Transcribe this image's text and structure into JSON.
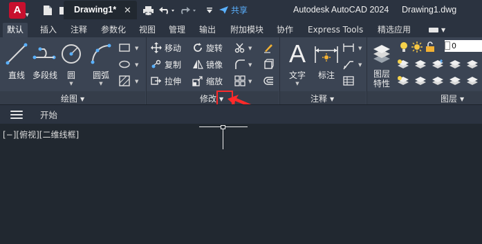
{
  "titlebar": {
    "logo_letter": "A",
    "share_label": "共享",
    "app_title": "Autodesk AutoCAD 2024",
    "file_name": "Drawing1.dwg",
    "quick_access": [
      "new-icon",
      "open-icon",
      "save-icon",
      "save-as-icon",
      "cloud-open-icon",
      "cloud-save-icon",
      "print-icon",
      "undo-icon",
      "redo-icon",
      "customize-icon"
    ]
  },
  "ribbon_tabs": [
    "默认",
    "插入",
    "注释",
    "参数化",
    "视图",
    "管理",
    "输出",
    "附加模块",
    "协作",
    "Express Tools",
    "精选应用"
  ],
  "ribbon": {
    "draw": {
      "title": "绘图",
      "line": "直线",
      "polyline": "多段线",
      "circle": "圆",
      "arc": "圆弧"
    },
    "modify": {
      "title": "修改",
      "move": "移动",
      "rotate": "旋转",
      "copy": "复制",
      "mirror": "镜像",
      "stretch": "拉伸",
      "scale": "缩放"
    },
    "annotation": {
      "title": "注释",
      "text": "文字",
      "dimension": "标注"
    },
    "layers": {
      "title": "图层",
      "properties_line1": "图层",
      "properties_line2": "特性",
      "current_layer": "0"
    }
  },
  "file_tabs": {
    "start": "开始",
    "active": "Drawing1*"
  },
  "viewport": {
    "label": "[−][俯视][二维线框]"
  },
  "colors": {
    "accent": "#c8102e",
    "share_blue": "#5ab1ff",
    "highlight_red": "#ff2a2a"
  }
}
